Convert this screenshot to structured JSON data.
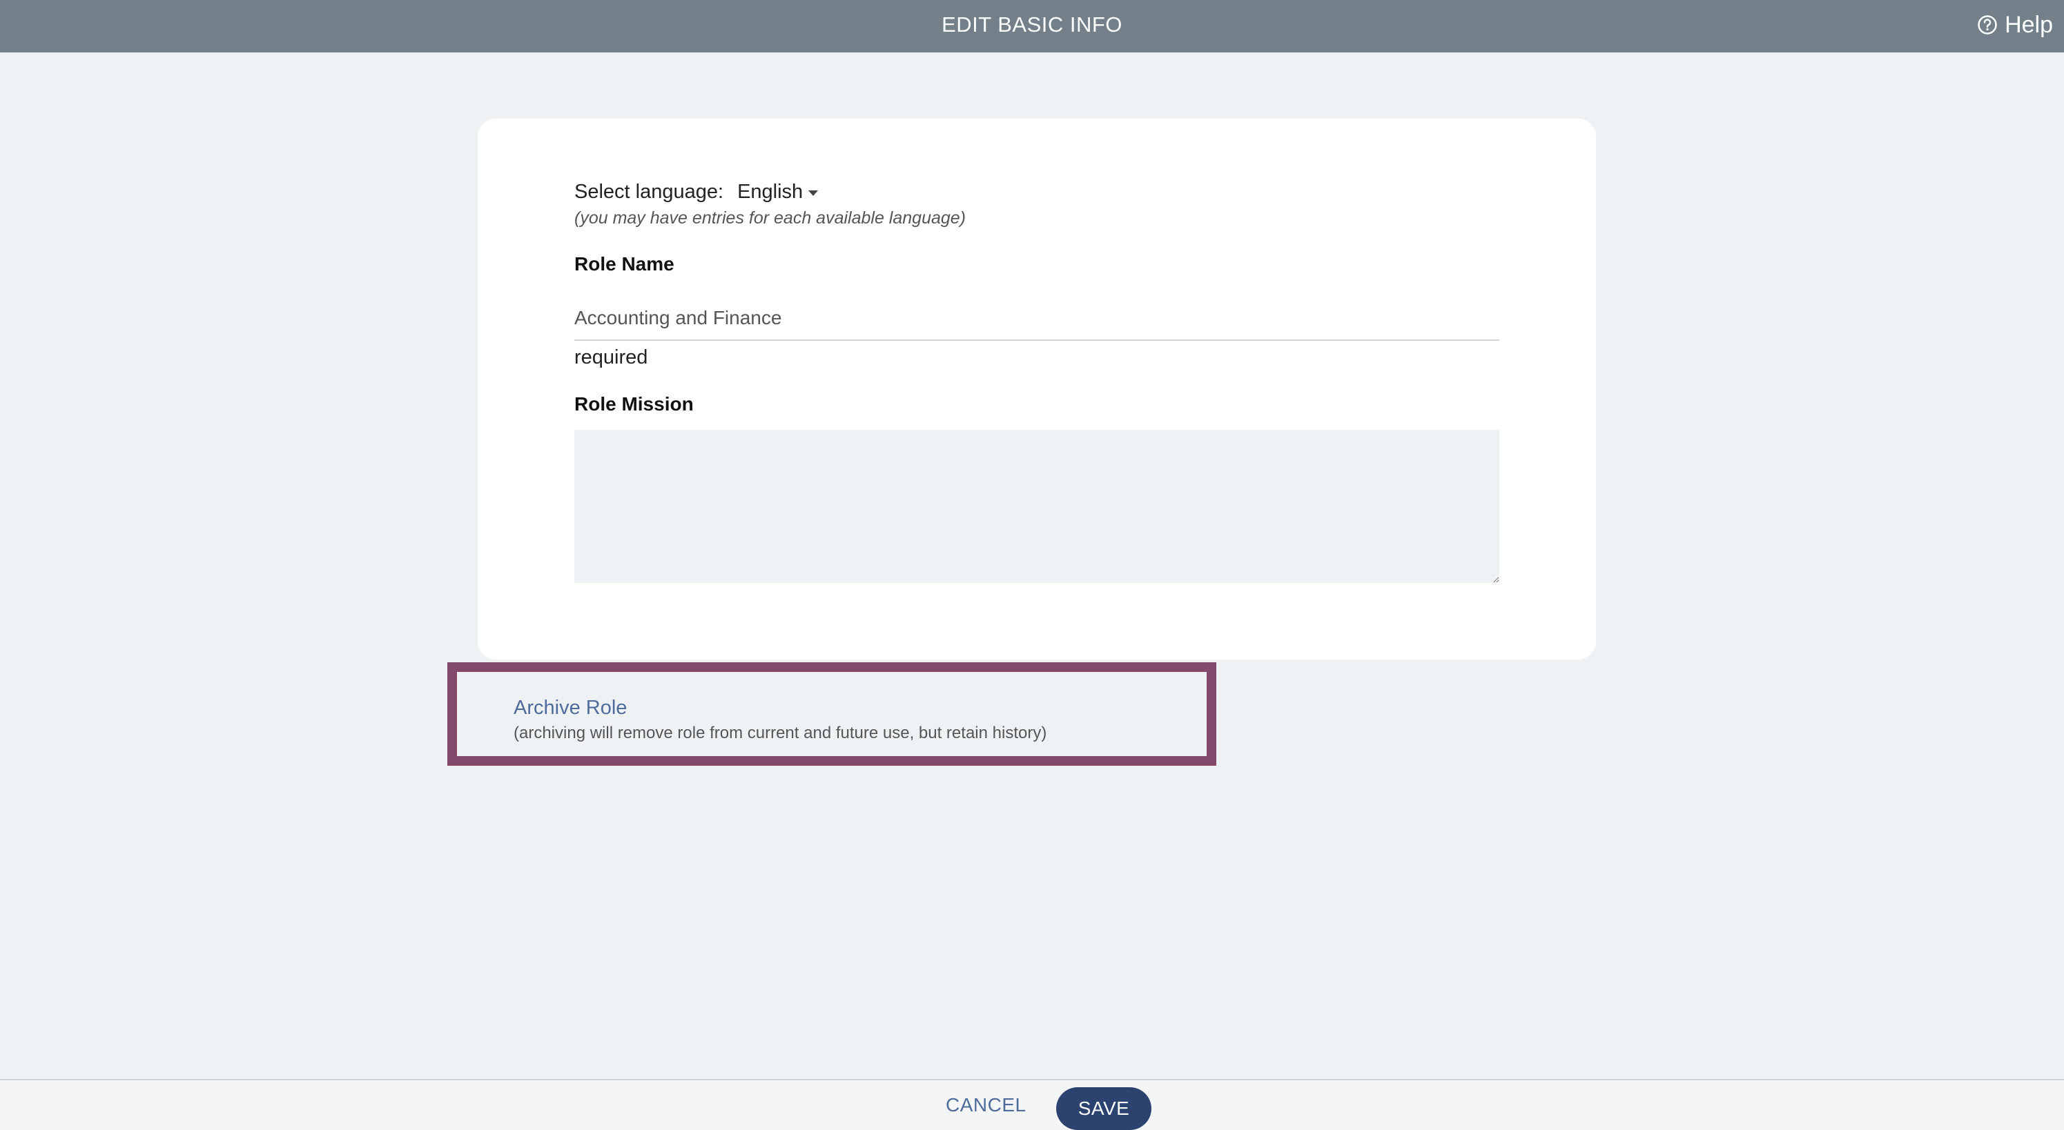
{
  "header": {
    "title": "EDIT BASIC INFO",
    "help_label": "Help"
  },
  "form": {
    "language_label": "Select language:",
    "language_value": "English",
    "language_hint": "(you may have entries for each available language)",
    "role_name_label": "Role Name",
    "role_name_value": "Accounting and Finance",
    "role_name_required": "required",
    "role_mission_label": "Role Mission",
    "role_mission_value": ""
  },
  "archive": {
    "link_label": "Archive Role",
    "note": "(archiving will remove role from current and future use, but retain history)",
    "highlight_color": "#834a6c"
  },
  "footer": {
    "cancel_label": "CANCEL",
    "save_label": "SAVE"
  },
  "colors": {
    "header_bg": "#738089",
    "page_bg": "#eff2f5",
    "link": "#4e6c9b",
    "primary_button": "#2c4370"
  },
  "icons": {
    "help": "help-circle-icon",
    "dropdown": "caret-down-icon"
  }
}
